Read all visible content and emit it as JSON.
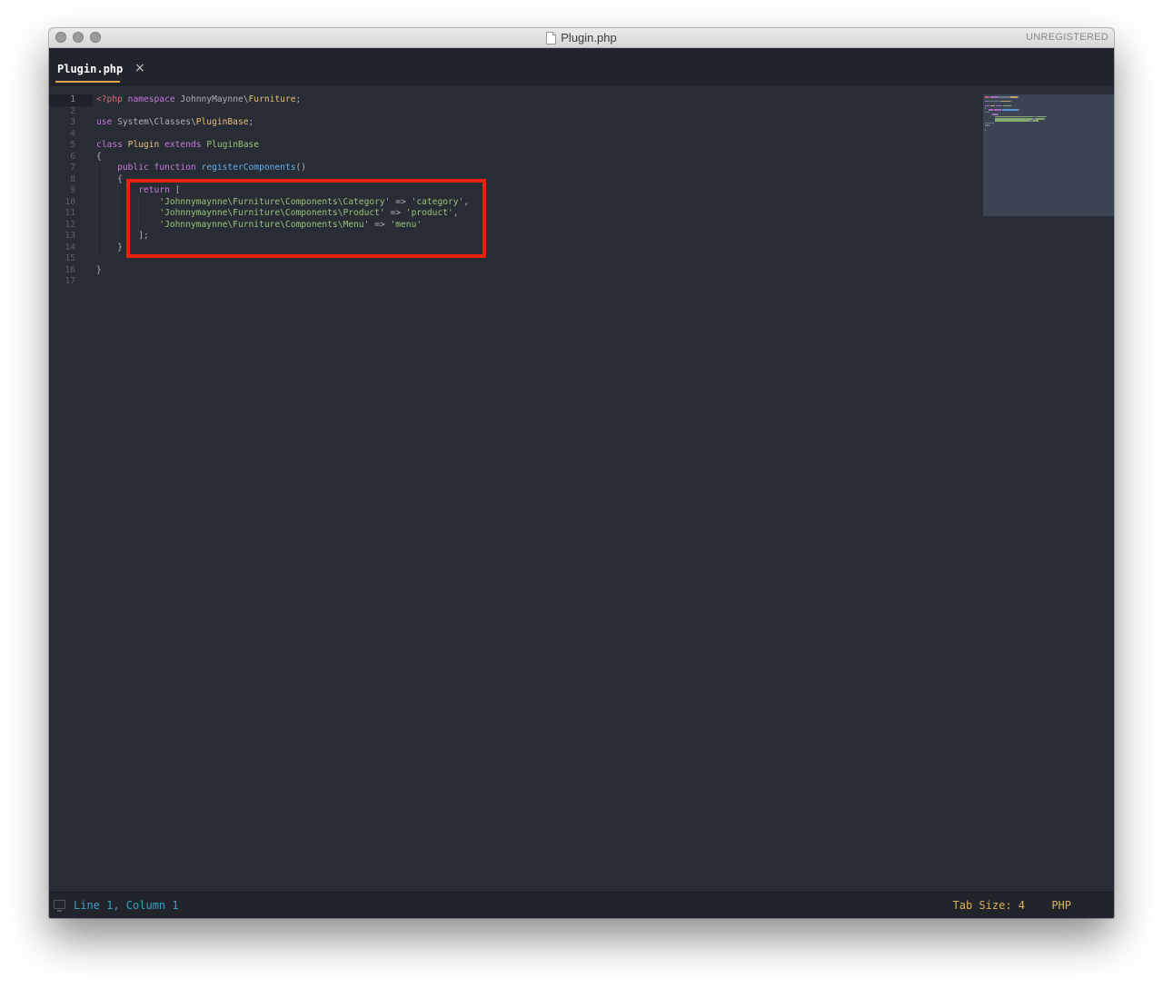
{
  "window": {
    "title": "Plugin.php",
    "registration": "UNREGISTERED"
  },
  "tab": {
    "label": "Plugin.php",
    "close_glyph": "×"
  },
  "code_lines": [
    {
      "n": "1",
      "tokens": [
        {
          "t": "<?php",
          "c": "#e06c75"
        },
        {
          "t": " "
        },
        {
          "t": "namespace",
          "c": "#c678dd"
        },
        {
          "t": " JohnnyMaynne\\"
        },
        {
          "t": "Furniture",
          "c": "#e5c07b"
        },
        {
          "t": ";"
        }
      ]
    },
    {
      "n": "2",
      "tokens": []
    },
    {
      "n": "3",
      "tokens": [
        {
          "t": "use",
          "c": "#c678dd"
        },
        {
          "t": " System\\Classes\\"
        },
        {
          "t": "PluginBase",
          "c": "#e5c07b"
        },
        {
          "t": ";"
        }
      ]
    },
    {
      "n": "4",
      "tokens": []
    },
    {
      "n": "5",
      "tokens": [
        {
          "t": "class",
          "c": "#c678dd"
        },
        {
          "t": " "
        },
        {
          "t": "Plugin",
          "c": "#e5c07b"
        },
        {
          "t": " "
        },
        {
          "t": "extends",
          "c": "#c678dd"
        },
        {
          "t": " "
        },
        {
          "t": "PluginBase",
          "c": "#98c379"
        }
      ]
    },
    {
      "n": "6",
      "tokens": [
        {
          "t": "{"
        }
      ]
    },
    {
      "n": "7",
      "tokens": [
        {
          "t": "    "
        },
        {
          "t": "public",
          "c": "#c678dd"
        },
        {
          "t": " "
        },
        {
          "t": "function",
          "c": "#c678dd"
        },
        {
          "t": " "
        },
        {
          "t": "registerComponents",
          "c": "#61afef"
        },
        {
          "t": "()"
        }
      ]
    },
    {
      "n": "8",
      "tokens": [
        {
          "t": "    {"
        }
      ]
    },
    {
      "n": "9",
      "tokens": [
        {
          "t": "        "
        },
        {
          "t": "return",
          "c": "#c678dd"
        },
        {
          "t": " ["
        }
      ]
    },
    {
      "n": "10",
      "tokens": [
        {
          "t": "            "
        },
        {
          "t": "'Johnnymaynne\\Furniture\\Components\\Category'",
          "c": "#98c379"
        },
        {
          "t": " => "
        },
        {
          "t": "'category'",
          "c": "#98c379"
        },
        {
          "t": ","
        }
      ]
    },
    {
      "n": "11",
      "tokens": [
        {
          "t": "            "
        },
        {
          "t": "'Johnnymaynne\\Furniture\\Components\\Product'",
          "c": "#98c379"
        },
        {
          "t": " => "
        },
        {
          "t": "'product'",
          "c": "#98c379"
        },
        {
          "t": ","
        }
      ]
    },
    {
      "n": "12",
      "tokens": [
        {
          "t": "            "
        },
        {
          "t": "'Johnnymaynne\\Furniture\\Components\\Menu'",
          "c": "#98c379"
        },
        {
          "t": " => "
        },
        {
          "t": "'menu'",
          "c": "#98c379"
        }
      ]
    },
    {
      "n": "13",
      "tokens": [
        {
          "t": "        ];"
        }
      ]
    },
    {
      "n": "14",
      "tokens": [
        {
          "t": "    }"
        }
      ]
    },
    {
      "n": "15",
      "tokens": []
    },
    {
      "n": "16",
      "tokens": [
        {
          "t": "}"
        }
      ]
    },
    {
      "n": "17",
      "tokens": []
    }
  ],
  "active_line": "1",
  "status": {
    "position": "Line 1, Column 1",
    "tab_size": "Tab Size: 4",
    "syntax": "PHP"
  },
  "colors": {
    "editor_bg": "#282c34",
    "highlight_box": "#e8220f",
    "tab_accent": "#e0a14a",
    "status_position": "#3a9fc5",
    "status_right": "#d8b15c"
  }
}
